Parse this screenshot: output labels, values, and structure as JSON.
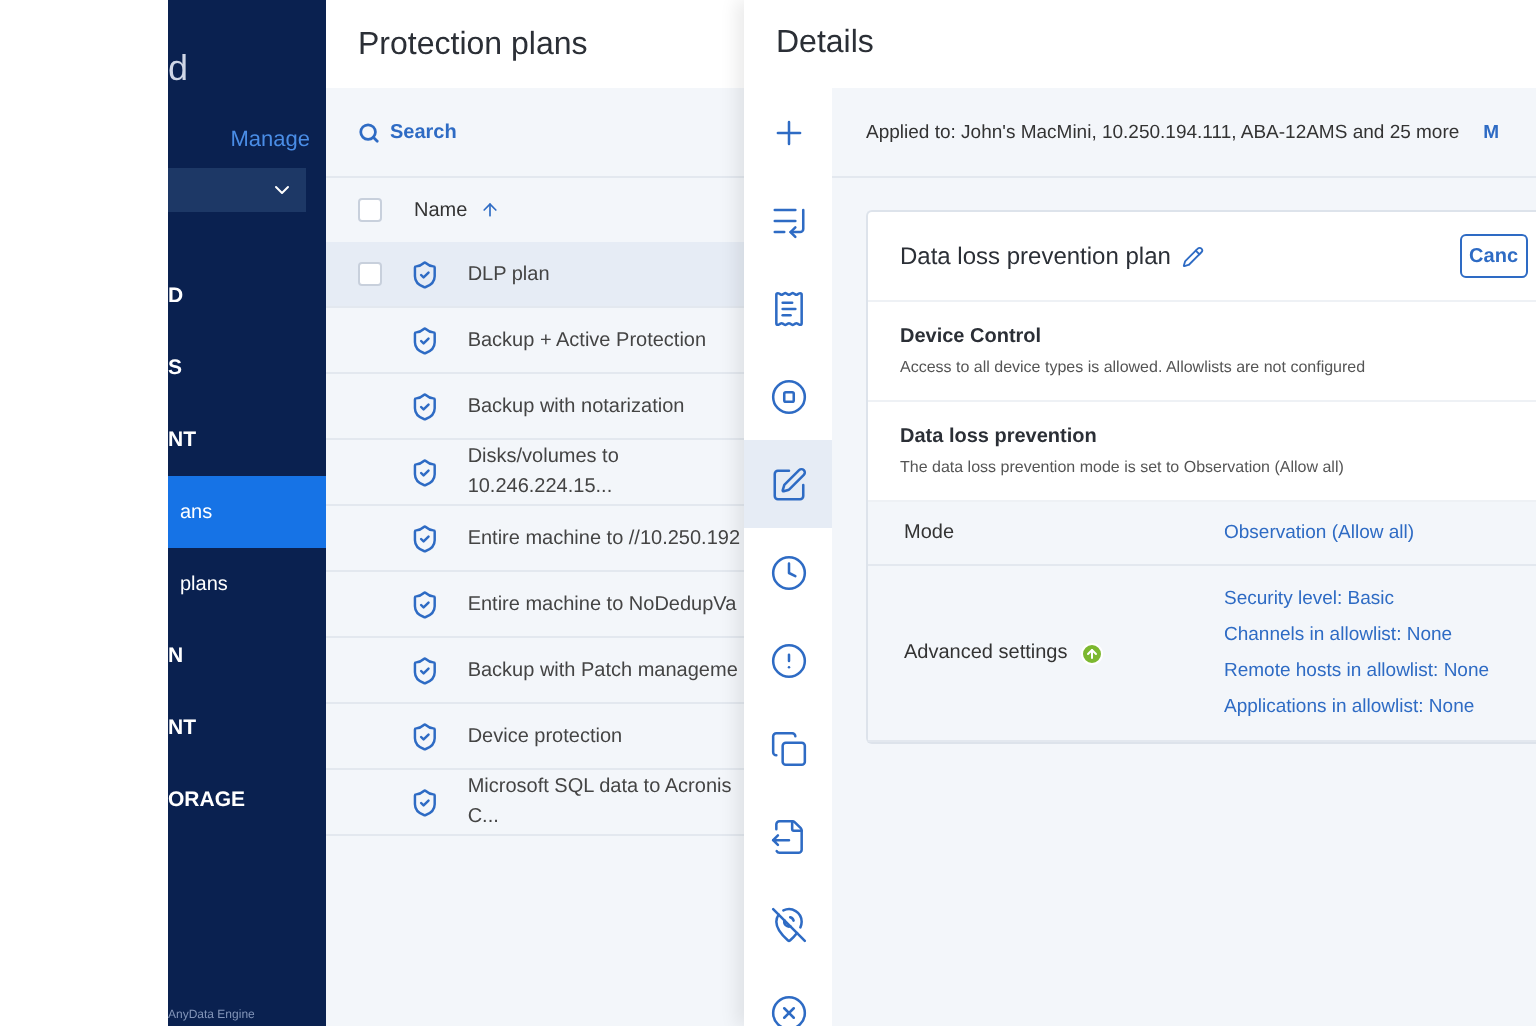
{
  "sidebar": {
    "logo_text": "d",
    "manage_link": "Manage",
    "items": [
      {
        "label": "D",
        "selected": false,
        "kind": "section"
      },
      {
        "label": "S",
        "selected": false,
        "kind": "section"
      },
      {
        "label": "NT",
        "selected": false,
        "kind": "section"
      },
      {
        "label": "ans",
        "selected": true,
        "kind": "sub"
      },
      {
        "label": "plans",
        "selected": false,
        "kind": "sub"
      },
      {
        "label": "N",
        "selected": false,
        "kind": "section"
      },
      {
        "label": "NT",
        "selected": false,
        "kind": "section"
      },
      {
        "label": "ORAGE",
        "selected": false,
        "kind": "section"
      }
    ],
    "footer": "AnyData Engine"
  },
  "plans": {
    "title": "Protection plans",
    "search": {
      "placeholder": "Search"
    },
    "column": "Name",
    "select_all": {
      "checked": false
    },
    "rows": [
      {
        "name": "DLP plan",
        "selected": true
      },
      {
        "name": "Backup + Active Protection",
        "selected": false
      },
      {
        "name": "Backup with notarization",
        "selected": false
      },
      {
        "name": "Disks/volumes to 10.246.224.15...",
        "selected": false
      },
      {
        "name": "Entire machine to //10.250.192",
        "selected": false
      },
      {
        "name": "Entire machine to NoDedupVa",
        "selected": false
      },
      {
        "name": "Backup with Patch manageme",
        "selected": false
      },
      {
        "name": "Device protection",
        "selected": false
      },
      {
        "name": "Microsoft SQL data to Acronis C...",
        "selected": false
      }
    ]
  },
  "details": {
    "title": "Details",
    "applied_to": "Applied to: John's MacMini, 10.250.194.111, ABA-12AMS and 25 more",
    "applied_link": "M",
    "rail": [
      {
        "kind": "plus",
        "selected": false
      },
      {
        "kind": "import",
        "selected": false
      },
      {
        "kind": "document",
        "selected": false
      },
      {
        "kind": "stop",
        "selected": false
      },
      {
        "kind": "edit",
        "selected": true
      },
      {
        "kind": "clock",
        "selected": false
      },
      {
        "kind": "alert",
        "selected": false
      },
      {
        "kind": "copy",
        "selected": false
      },
      {
        "kind": "export",
        "selected": false
      },
      {
        "kind": "pin-off",
        "selected": false
      },
      {
        "kind": "close",
        "selected": false
      }
    ],
    "plan": {
      "title": "Data loss prevention plan",
      "cancel": "Canc",
      "sections": [
        {
          "title": "Device Control",
          "description": "Access to all device types is allowed. Allowlists are not configured"
        },
        {
          "title": "Data loss prevention",
          "description": "The data loss prevention mode is set to Observation (Allow all)"
        }
      ],
      "mode": {
        "label": "Mode",
        "value": "Observation (Allow all)"
      },
      "advanced": {
        "label": "Advanced settings",
        "values": [
          "Security level: Basic",
          "Channels in allowlist: None",
          "Remote hosts in allowlist: None",
          "Applications in allowlist: None"
        ]
      }
    }
  }
}
